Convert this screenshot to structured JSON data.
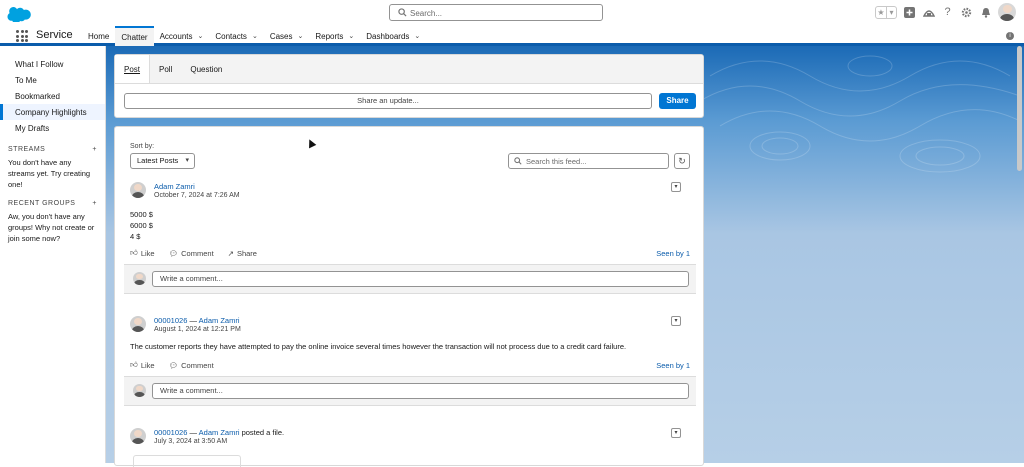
{
  "header": {
    "search_placeholder": "Search...",
    "help_icon": "?",
    "app_name": "Service"
  },
  "nav": {
    "items": [
      {
        "label": "Home",
        "active": false,
        "dropdown": false
      },
      {
        "label": "Chatter",
        "active": true,
        "dropdown": false
      },
      {
        "label": "Accounts",
        "active": false,
        "dropdown": true
      },
      {
        "label": "Contacts",
        "active": false,
        "dropdown": true
      },
      {
        "label": "Cases",
        "active": false,
        "dropdown": true
      },
      {
        "label": "Reports",
        "active": false,
        "dropdown": true
      },
      {
        "label": "Dashboards",
        "active": false,
        "dropdown": true
      }
    ]
  },
  "sidebar": {
    "items": [
      "What I Follow",
      "To Me",
      "Bookmarked",
      "Company Highlights",
      "My Drafts"
    ],
    "active_index": 3,
    "streams_header": "STREAMS",
    "streams_empty": "You don't have any streams yet. Try creating one!",
    "groups_header": "RECENT GROUPS",
    "groups_empty": "Aw, you don't have any groups! Why not create or join some now?",
    "add_symbol": "+"
  },
  "publisher": {
    "tabs": [
      "Post",
      "Poll",
      "Question"
    ],
    "share_placeholder": "Share an update...",
    "share_button": "Share"
  },
  "feed": {
    "sort_label": "Sort by:",
    "sort_value": "Latest Posts",
    "search_placeholder": "Search this feed...",
    "comment_placeholder": "Write a comment...",
    "like_label": "Like",
    "comment_label": "Comment",
    "share_label": "Share",
    "posts": [
      {
        "author": "Adam Zamri",
        "date": "October 7, 2024 at 7:26 AM",
        "lines": [
          "5000 $",
          "6000 $",
          "4 $"
        ],
        "seen": "Seen by 1"
      },
      {
        "record": "00001026",
        "separator": "—",
        "author": "Adam Zamri",
        "date": "August 1, 2024 at 12:21 PM",
        "text": "The customer reports they have attempted to pay the online invoice several times however the transaction will not process due to a credit card failure.",
        "seen": "Seen by 1"
      },
      {
        "record": "00001026",
        "separator": "—",
        "author": "Adam Zamri",
        "action": "posted a file.",
        "date": "July 3, 2024 at 3:50 AM"
      }
    ]
  },
  "colors": {
    "brand": "#0176d3",
    "link": "#0b5cab",
    "background_top": "#1b6ab6",
    "background_bottom": "#b6cfe7"
  }
}
